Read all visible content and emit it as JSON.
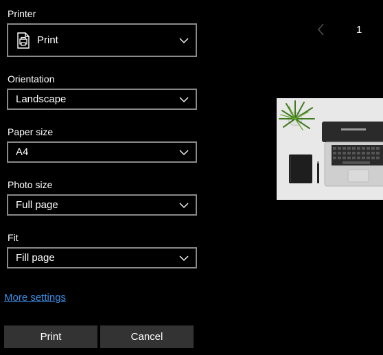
{
  "printer": {
    "label": "Printer",
    "value": "Print"
  },
  "orientation": {
    "label": "Orientation",
    "value": "Landscape"
  },
  "paper_size": {
    "label": "Paper size",
    "value": "A4"
  },
  "photo_size": {
    "label": "Photo size",
    "value": "Full page"
  },
  "fit": {
    "label": "Fit",
    "value": "Fill page"
  },
  "more_settings": "More settings",
  "buttons": {
    "print": "Print",
    "cancel": "Cancel"
  },
  "pager": {
    "page": "1"
  },
  "icons": {
    "printer": "printer-icon",
    "dropdown": "chevron-down-icon",
    "prev": "chevron-left-icon"
  },
  "colors": {
    "background": "#000000",
    "field_border": "#8a8a8a",
    "link": "#3a8ee6",
    "button": "#333333"
  }
}
